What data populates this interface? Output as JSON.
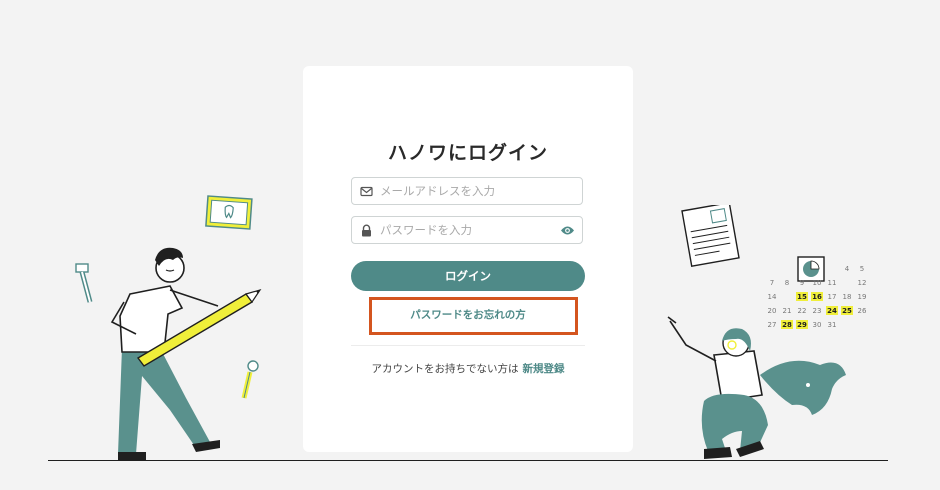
{
  "login": {
    "title": "ハノワにログイン",
    "email_placeholder": "メールアドレスを入力",
    "password_placeholder": "パスワードを入力",
    "submit_label": "ログイン",
    "forgot_password_label": "パスワードをお忘れの方",
    "signup_prompt": "アカウントをお持ちでない方は",
    "signup_link": "新規登録"
  },
  "calendar": {
    "rows": [
      [
        "",
        "",
        "",
        "",
        "",
        "4",
        "5"
      ],
      [
        "7",
        "8",
        "9",
        "10",
        "11",
        "",
        "12"
      ],
      [
        "14",
        "",
        "15",
        "16",
        "17",
        "18",
        "19"
      ],
      [
        "20",
        "21",
        "22",
        "23",
        "24",
        "25",
        "26"
      ],
      [
        "27",
        "28",
        "29",
        "30",
        "31",
        "",
        ""
      ]
    ],
    "highlighted": [
      "15",
      "16",
      "24",
      "25",
      "28",
      "29"
    ]
  },
  "colors": {
    "brand": "#4f8a88",
    "highlight_box": "#d4551f",
    "accent_yellow": "#f0ef3a",
    "background": "#f3f3f3"
  },
  "icons": {
    "email": "envelope-icon",
    "password": "lock-icon",
    "toggle_visibility": "eye-icon"
  }
}
